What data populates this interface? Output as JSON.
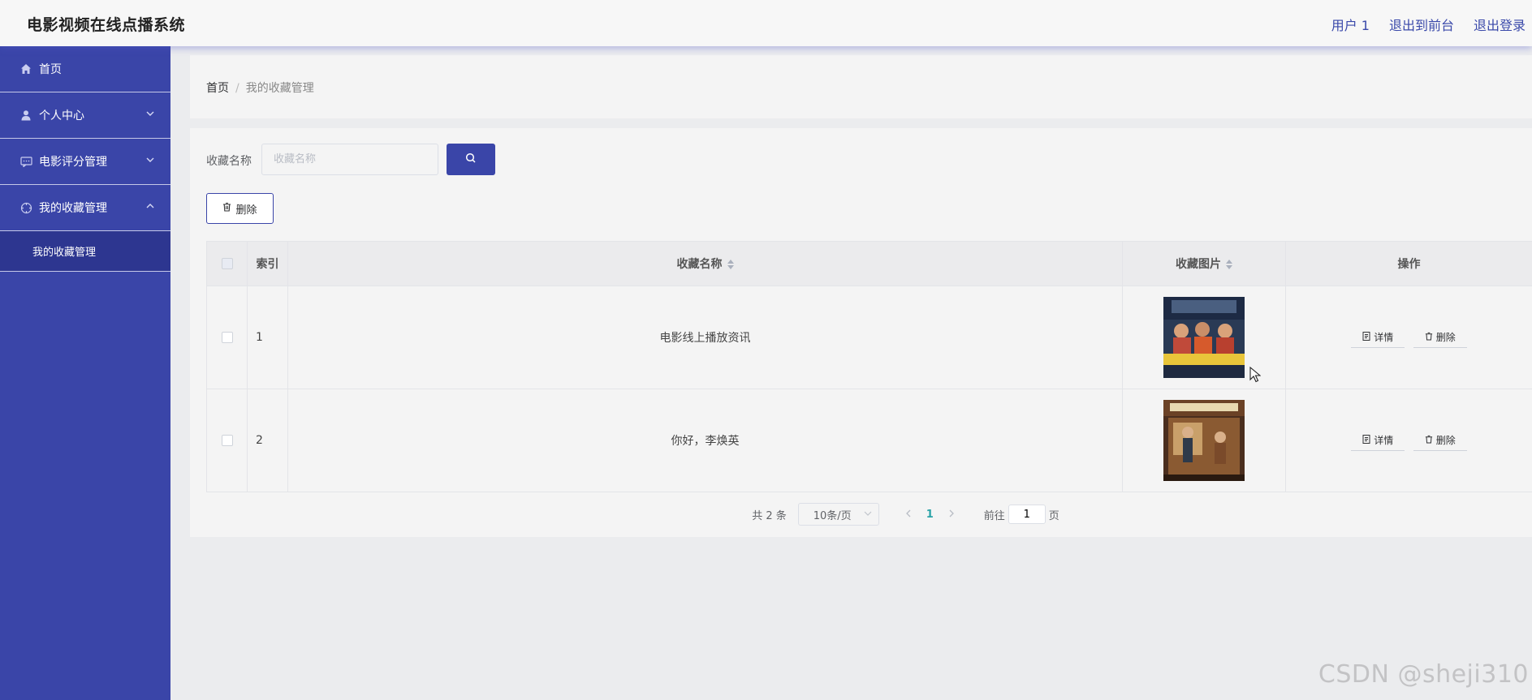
{
  "header": {
    "app_title": "电影视频在线点播系统",
    "user_label": "用户 1",
    "exit_front_label": "退出到前台",
    "logout_label": "退出登录"
  },
  "sidebar": {
    "items": [
      {
        "label": "首页",
        "icon": "home-icon"
      },
      {
        "label": "个人中心",
        "icon": "user-icon",
        "chevron": "down"
      },
      {
        "label": "电影评分管理",
        "icon": "chat-icon",
        "chevron": "down"
      },
      {
        "label": "我的收藏管理",
        "icon": "compass-icon",
        "chevron": "up",
        "expanded": true
      }
    ],
    "submenu": [
      {
        "label": "我的收藏管理"
      }
    ],
    "colors": {
      "bg": "#3a45a8",
      "active_sub_bg": "#2d3690"
    }
  },
  "breadcrumb": {
    "home": "首页",
    "separator": "/",
    "current": "我的收藏管理"
  },
  "search": {
    "label": "收藏名称",
    "placeholder": "收藏名称",
    "value": ""
  },
  "toolbar": {
    "delete_label": "删除"
  },
  "table": {
    "columns": [
      "索引",
      "收藏名称",
      "收藏图片",
      "操作"
    ],
    "rows": [
      {
        "index": "1",
        "name": "电影线上播放资讯",
        "image": "poster-1"
      },
      {
        "index": "2",
        "name": "你好，李焕英",
        "image": "poster-2"
      }
    ],
    "detail_label": "详情",
    "delete_label": "删除"
  },
  "pagination": {
    "total_text": "共 2 条",
    "page_size": "10条/页",
    "current_page": "1",
    "goto_prefix": "前往",
    "goto_value": "1",
    "goto_suffix": "页",
    "current_color": "#2aa3a7"
  },
  "watermark": "CSDN @sheji310"
}
